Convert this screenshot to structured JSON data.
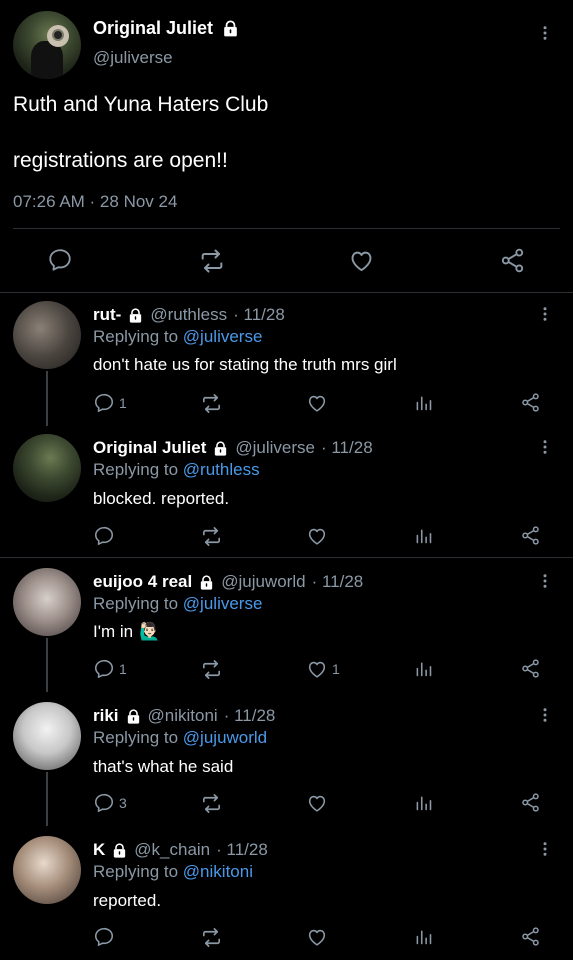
{
  "main_tweet": {
    "display_name": "Original Juliet",
    "handle": "@juliverse",
    "text_line1": "Ruth and Yuna Haters Club",
    "text_line2": "registrations are open!!",
    "timestamp": "07:26 AM · 28 Nov 24",
    "actions": [
      "reply-icon",
      "retweet-icon",
      "like-icon",
      "share-icon"
    ]
  },
  "replies": [
    {
      "display_name": "rut-",
      "handle": "@ruthless",
      "date": "· 11/28",
      "replying_label": "Replying to",
      "replying_to": "@juliverse",
      "text": "don't hate us for stating the truth mrs girl",
      "reply_count": "1",
      "like_count": ""
    },
    {
      "display_name": "Original Juliet",
      "handle": "@juliverse",
      "date": "· 11/28",
      "replying_label": "Replying to",
      "replying_to": "@ruthless",
      "text": "blocked. reported.",
      "reply_count": "",
      "like_count": ""
    },
    {
      "display_name": "euijoo 4 real",
      "handle": "@jujuworld",
      "date": "· 11/28",
      "replying_label": "Replying to",
      "replying_to": "@juliverse",
      "text": "I'm in",
      "emoji": "🙋🏻‍♂️",
      "reply_count": "1",
      "like_count": "1"
    },
    {
      "display_name": "riki",
      "handle": "@nikitoni",
      "date": "· 11/28",
      "replying_label": "Replying to",
      "replying_to": "@jujuworld",
      "text": "that's what he said",
      "reply_count": "3",
      "like_count": ""
    },
    {
      "display_name": "K",
      "handle": "@k_chain",
      "date": "· 11/28",
      "replying_label": "Replying to",
      "replying_to": "@nikitoni",
      "text": "reported.",
      "reply_count": "",
      "like_count": ""
    }
  ],
  "colors": {
    "background": "#000000",
    "text": "#ffffff",
    "muted": "#8b98a5",
    "link": "#4a99e9",
    "divider": "#2b2f33"
  }
}
